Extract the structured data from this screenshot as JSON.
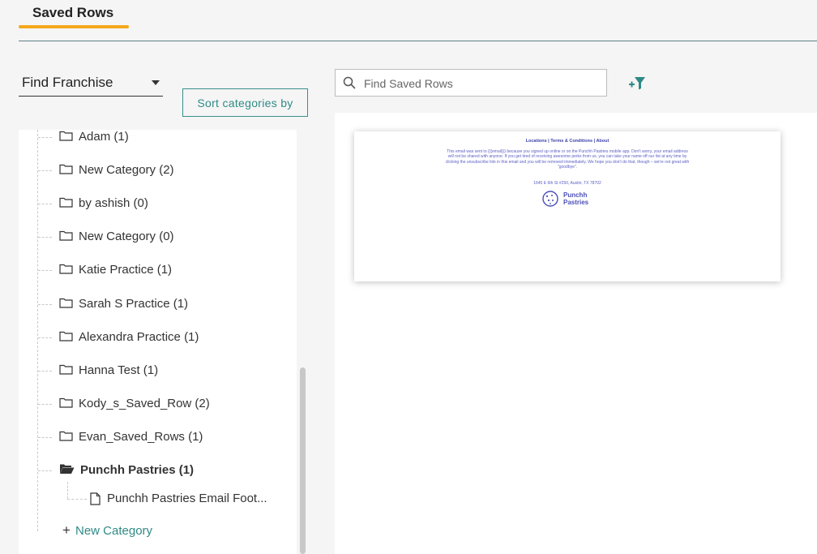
{
  "tabs": [
    {
      "label": "Saved Rows",
      "active": true
    }
  ],
  "franchise_select": {
    "value": "Find Franchise"
  },
  "sort_button": {
    "label": "Sort categories by"
  },
  "search": {
    "placeholder": "Find Saved Rows",
    "value": ""
  },
  "filter": {
    "icon": "add-filter-icon"
  },
  "tree": {
    "items": [
      {
        "label": "Adam (1)",
        "icon": "folder-icon"
      },
      {
        "label": "New Category (2)",
        "icon": "folder-icon"
      },
      {
        "label": "by ashish (0)",
        "icon": "folder-icon"
      },
      {
        "label": "New Category (0)",
        "icon": "folder-icon"
      },
      {
        "label": "Katie Practice (1)",
        "icon": "folder-icon"
      },
      {
        "label": "Sarah S Practice (1)",
        "icon": "folder-icon"
      },
      {
        "label": "Alexandra Practice (1)",
        "icon": "folder-icon"
      },
      {
        "label": "Hanna Test (1)",
        "icon": "folder-icon"
      },
      {
        "label": "Kody_s_Saved_Row (2)",
        "icon": "folder-icon"
      },
      {
        "label": "Evan_Saved_Rows (1)",
        "icon": "folder-icon"
      },
      {
        "label": "Punchh Pastries (1)",
        "icon": "folder-open-icon",
        "expanded": true
      }
    ],
    "child": {
      "label": "Punchh Pastries Email Foot...",
      "icon": "file-icon"
    },
    "new_category": {
      "label": "New Category"
    }
  },
  "preview": {
    "links": "Locations | Terms & Conditions | About",
    "body": "This email was sent to {{{email}}} because you signed up online or on the Punchh Pastries mobile app. Don't worry, your email address will not be shared with anyone. If you get tired of receiving awesome perks from us, you can take your name off our list at any time by clicking the unsubscribe link in this email and you will be removed immediately. We hope you don't do that, though – we're not great with \"goodbye\".",
    "address": "1645 E 6th St #250, Austin, TX 78702",
    "logo_line1": "Punchh",
    "logo_line2": "Pastries"
  },
  "colors": {
    "accent": "#f4a81c",
    "teal": "#2f8a86",
    "brand": "#4b4fb8"
  }
}
